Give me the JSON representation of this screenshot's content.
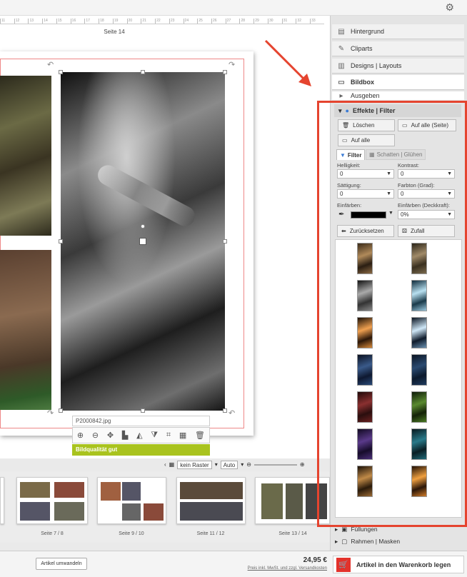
{
  "page": {
    "title": "Seite 14",
    "filename": "P2000842.jpg",
    "quality_label": "Bildqualität gut"
  },
  "ruler": {
    "ticks": [
      "11",
      "12",
      "13",
      "14",
      "15",
      "16",
      "17",
      "18",
      "19",
      "20",
      "21",
      "22",
      "23",
      "24",
      "25",
      "26",
      "27",
      "28",
      "29",
      "30",
      "31",
      "32",
      "33"
    ]
  },
  "toolbar_icons": [
    "zoom-in-icon",
    "zoom-out-icon",
    "move-icon",
    "replace-image-icon",
    "flip-horizontal-icon",
    "flip-vertical-icon",
    "crop-icon",
    "effects-icon",
    "delete-icon"
  ],
  "zoombar": {
    "raster": "kein Raster",
    "zoom": "Auto"
  },
  "thumbnails": [
    {
      "label": ""
    },
    {
      "label": "Seite 7 / 8"
    },
    {
      "label": "Seite 9 / 10"
    },
    {
      "label": "Seite 11 / 12"
    },
    {
      "label": "Seite 13 / 14"
    }
  ],
  "bottom": {
    "convert_label": "Artikel umwandeln",
    "price": "24,95 €",
    "price_note": "Preis inkl. MwSt. und zzgl. Versandkosten",
    "cart_label": "Artikel in den Warenkorb legen"
  },
  "panel": {
    "sections": [
      "Hintergrund",
      "Cliparts",
      "Designs | Layouts",
      "Bildbox",
      "Ausgeben"
    ],
    "effects": {
      "header": "Effekte | Filter",
      "delete_label": "Löschen",
      "apply_page_label": "Auf alle (Seite)",
      "apply_all_label": "Auf alle",
      "tab_filter": "Filter",
      "tab_shadow": "Schatten | Glühen",
      "brightness_label": "Helligkeit:",
      "brightness_value": "0",
      "contrast_label": "Kontrast:",
      "contrast_value": "0",
      "saturation_label": "Sättigung:",
      "saturation_value": "0",
      "hue_label": "Farbton (Grad):",
      "hue_value": "0",
      "colorize_label": "Einfärben:",
      "colorize_opacity_label": "Einfärben (Deckkraft):",
      "colorize_opacity_value": "0%",
      "colorize_color": "#000000",
      "reset_label": "Zurücksetzen",
      "random_label": "Zufall"
    },
    "more_sections": [
      "Füllungen",
      "Rahmen | Masken"
    ]
  },
  "colors": {
    "accent_red": "#e5442f",
    "quality_green": "#a9c31e"
  }
}
